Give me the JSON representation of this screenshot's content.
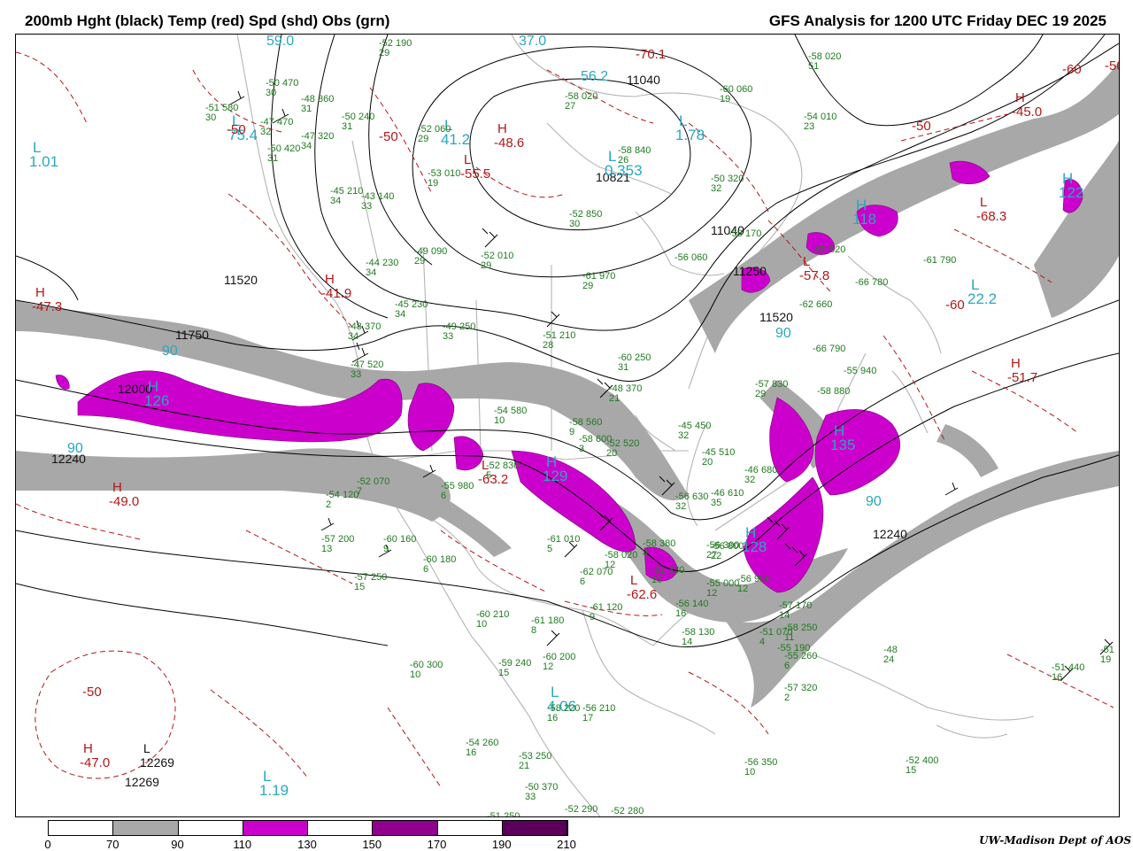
{
  "title_left": "200mb Hght (black) Temp (red) Spd (shd) Obs (grn)",
  "title_right": "GFS Analysis for 1200 UTC Friday  DEC 19 2025",
  "credit": "UW-Madison  Dept of AOS",
  "colors": {
    "height": "#000000",
    "temp": "#b01818",
    "speed_70_90": "#a8a8a8",
    "speed_110_130": "#cc00cc",
    "obs": "#1f7a1f",
    "max_label": "#2aa7bf",
    "coast": "#b4b4b4"
  },
  "legend": {
    "ticks": [
      "0",
      "70",
      "90",
      "110",
      "130",
      "150",
      "170",
      "190",
      "210"
    ],
    "bins": [
      {
        "from": 0,
        "to": 70,
        "color": "#ffffff"
      },
      {
        "from": 70,
        "to": 90,
        "color": "#a8a8a8"
      },
      {
        "from": 90,
        "to": 110,
        "color": "#ffffff"
      },
      {
        "from": 110,
        "to": 130,
        "color": "#cc00cc"
      },
      {
        "from": 130,
        "to": 150,
        "color": "#ffffff"
      },
      {
        "from": 150,
        "to": 170,
        "color": "#8f008f"
      },
      {
        "from": 170,
        "to": 190,
        "color": "#ffffff"
      },
      {
        "from": 190,
        "to": 210,
        "color": "#5a005a"
      }
    ]
  },
  "height_labels": [
    "11040",
    "10821",
    "11040",
    "11250",
    "11520",
    "11520",
    "11750",
    "12000",
    "12240",
    "12240",
    "12269"
  ],
  "extrema": [
    {
      "symbol": "L",
      "value": "1.01",
      "kind": "speed-min"
    },
    {
      "symbol": "L",
      "value": "75.4",
      "kind": "speed-min"
    },
    {
      "symbol": "L",
      "value": "41.2",
      "kind": "speed-min"
    },
    {
      "symbol": "L",
      "value": "0.353",
      "kind": "speed-min"
    },
    {
      "symbol": "L",
      "value": "1.78",
      "kind": "speed-min"
    },
    {
      "symbol": "L",
      "value": "22.2",
      "kind": "speed-min"
    },
    {
      "symbol": "L",
      "value": "4.06",
      "kind": "speed-min"
    },
    {
      "symbol": "L",
      "value": "1.19",
      "kind": "speed-min"
    },
    {
      "symbol": "H",
      "value": "126",
      "kind": "speed-max"
    },
    {
      "symbol": "H",
      "value": "129",
      "kind": "speed-max"
    },
    {
      "symbol": "H",
      "value": "118",
      "kind": "speed-max"
    },
    {
      "symbol": "H",
      "value": "122",
      "kind": "speed-max"
    },
    {
      "symbol": "H",
      "value": "135",
      "kind": "speed-max"
    },
    {
      "symbol": "H",
      "value": "128",
      "kind": "speed-max"
    },
    {
      "symbol": "H",
      "value": "-47.3",
      "kind": "temp-max"
    },
    {
      "symbol": "H",
      "value": "-41.9",
      "kind": "temp-max"
    },
    {
      "symbol": "H",
      "value": "-49.0",
      "kind": "temp-max"
    },
    {
      "symbol": "H",
      "value": "-47.0",
      "kind": "temp-max"
    },
    {
      "symbol": "H",
      "value": "-45.0",
      "kind": "temp-max"
    },
    {
      "symbol": "H",
      "value": "-51.7",
      "kind": "temp-max"
    },
    {
      "symbol": "H",
      "value": "-48.6",
      "kind": "temp-max"
    },
    {
      "symbol": "L",
      "value": "-55.5",
      "kind": "temp-min"
    },
    {
      "symbol": "L",
      "value": "-68.3",
      "kind": "temp-min"
    },
    {
      "symbol": "L",
      "value": "-57.8",
      "kind": "temp-min"
    },
    {
      "symbol": "L",
      "value": "-62.6",
      "kind": "temp-min"
    },
    {
      "symbol": "L",
      "value": "-63.2",
      "kind": "temp-min"
    },
    {
      "symbol": "L",
      "value": "12269",
      "kind": "height-min"
    }
  ],
  "speed_values": [
    "59.0",
    "37.0",
    "56.2",
    "90",
    "90",
    "90",
    "90"
  ],
  "temp_labels": [
    "-50",
    "-50",
    "-50",
    "-50",
    "-60",
    "-60",
    "-50",
    "-70.1"
  ],
  "stations": [
    {
      "t": "-52",
      "h": "190",
      "d": "29"
    },
    {
      "t": "-50",
      "h": "470",
      "d": "30"
    },
    {
      "t": "-51",
      "h": "580",
      "d": "30"
    },
    {
      "t": "-47",
      "h": "470",
      "d": "32"
    },
    {
      "t": "-48",
      "h": "360",
      "d": "31"
    },
    {
      "t": "-47",
      "h": "320",
      "d": "34"
    },
    {
      "t": "-50",
      "h": "420",
      "d": "31"
    },
    {
      "t": "-50",
      "h": "240",
      "d": "31"
    },
    {
      "t": "-52",
      "h": "060",
      "d": "29"
    },
    {
      "t": "-58",
      "h": "020",
      "d": "51"
    },
    {
      "t": "-60",
      "h": "060",
      "d": "19"
    },
    {
      "t": "-58",
      "h": "020",
      "d": "27"
    },
    {
      "t": "-54",
      "h": "010",
      "d": "23"
    },
    {
      "t": "-58",
      "h": "840",
      "d": "26"
    },
    {
      "t": "-53",
      "h": "010",
      "d": "19"
    },
    {
      "t": "-45",
      "h": "210",
      "d": "34"
    },
    {
      "t": "-43",
      "h": "140",
      "d": "33"
    },
    {
      "t": "-50",
      "h": "320",
      "d": "32"
    },
    {
      "t": "-52",
      "h": "850",
      "d": "30"
    },
    {
      "t": "-49",
      "h": "090",
      "d": "29"
    },
    {
      "t": "-52",
      "h": "010",
      "d": "29"
    },
    {
      "t": "-44",
      "h": "230",
      "d": "34"
    },
    {
      "t": "-56",
      "h": "060",
      "d": ""
    },
    {
      "t": "-58",
      "h": "170",
      "d": ""
    },
    {
      "t": "-61",
      "h": "970",
      "d": "29"
    },
    {
      "t": "-61",
      "h": "790",
      "d": ""
    },
    {
      "t": "-60",
      "h": "520",
      "d": ""
    },
    {
      "t": "-66",
      "h": "780",
      "d": ""
    },
    {
      "t": "-45",
      "h": "230",
      "d": "34"
    },
    {
      "t": "-48",
      "h": "370",
      "d": "34"
    },
    {
      "t": "-49",
      "h": "250",
      "d": "33"
    },
    {
      "t": "-51",
      "h": "210",
      "d": "28"
    },
    {
      "t": "-62",
      "h": "660",
      "d": ""
    },
    {
      "t": "-60",
      "h": "250",
      "d": "31"
    },
    {
      "t": "-66",
      "h": "790",
      "d": ""
    },
    {
      "t": "-55",
      "h": "940",
      "d": ""
    },
    {
      "t": "-47",
      "h": "520",
      "d": "33"
    },
    {
      "t": "-48",
      "h": "370",
      "d": "21"
    },
    {
      "t": "-57",
      "h": "830",
      "d": "29"
    },
    {
      "t": "-58",
      "h": "880",
      "d": ""
    },
    {
      "t": "-45",
      "h": "450",
      "d": "32"
    },
    {
      "t": "-45",
      "h": "510",
      "d": "20"
    },
    {
      "t": "-56",
      "h": "800",
      "d": "22"
    },
    {
      "t": "-46",
      "h": "680",
      "d": "32"
    },
    {
      "t": "-54",
      "h": "580",
      "d": "10"
    },
    {
      "t": "-58",
      "h": "560",
      "d": "9"
    },
    {
      "t": "-52",
      "h": "520",
      "d": "20"
    },
    {
      "t": "-58",
      "h": "600",
      "d": "3"
    },
    {
      "t": "-52",
      "h": "830",
      "d": "5"
    },
    {
      "t": "-55",
      "h": "980",
      "d": "6"
    },
    {
      "t": "-52",
      "h": "070",
      "d": "7"
    },
    {
      "t": "-54",
      "h": "120",
      "d": "2"
    },
    {
      "t": "-56",
      "h": "630",
      "d": "32"
    },
    {
      "t": "-46",
      "h": "610",
      "d": "35"
    },
    {
      "t": "-57",
      "h": "200",
      "d": "13"
    },
    {
      "t": "-60",
      "h": "160",
      "d": "9"
    },
    {
      "t": "-60",
      "h": "180",
      "d": "6"
    },
    {
      "t": "-57",
      "h": "250",
      "d": "15"
    },
    {
      "t": "-61",
      "h": "010",
      "d": "5"
    },
    {
      "t": "-62",
      "h": "070",
      "d": "6"
    },
    {
      "t": "-58",
      "h": "020",
      "d": "12"
    },
    {
      "t": "-61",
      "h": "120",
      "d": "9"
    },
    {
      "t": "-58",
      "h": "380",
      "d": "4"
    },
    {
      "t": "-61",
      "h": "330",
      "d": "10"
    },
    {
      "t": "-56",
      "h": "300",
      "d": "27"
    },
    {
      "t": "-56",
      "h": "950",
      "d": "12"
    },
    {
      "t": "-55",
      "h": "000",
      "d": "12"
    },
    {
      "t": "-56",
      "h": "140",
      "d": "16"
    },
    {
      "t": "-58",
      "h": "130",
      "d": "14"
    },
    {
      "t": "-57",
      "h": "170",
      "d": "14"
    },
    {
      "t": "-58",
      "h": "250",
      "d": "11"
    },
    {
      "t": "-55",
      "h": "190",
      "d": ""
    },
    {
      "t": "-60",
      "h": "210",
      "d": "10"
    },
    {
      "t": "-61",
      "h": "180",
      "d": "8"
    },
    {
      "t": "-60",
      "h": "300",
      "d": "10"
    },
    {
      "t": "-59",
      "h": "240",
      "d": "15"
    },
    {
      "t": "-60",
      "h": "200",
      "d": "12"
    },
    {
      "t": "-58",
      "h": "220",
      "d": "16"
    },
    {
      "t": "-56",
      "h": "210",
      "d": "17"
    },
    {
      "t": "-57",
      "h": "320",
      "d": "2"
    },
    {
      "t": "-54",
      "h": "260",
      "d": "16"
    },
    {
      "t": "-53",
      "h": "250",
      "d": "21"
    },
    {
      "t": "-50",
      "h": "370",
      "d": "33"
    },
    {
      "t": "-51",
      "h": "250",
      "d": ""
    },
    {
      "t": "-52",
      "h": "290",
      "d": ""
    },
    {
      "t": "-52",
      "h": "280",
      "d": ""
    },
    {
      "t": "-56",
      "h": "350",
      "d": "10"
    },
    {
      "t": "-52",
      "h": "400",
      "d": "15"
    },
    {
      "t": "-51",
      "h": "440",
      "d": "16"
    },
    {
      "t": "-51",
      "h": "",
      "d": "19"
    },
    {
      "t": "-55",
      "h": "260",
      "d": "6"
    },
    {
      "t": "-51",
      "h": "070",
      "d": "4"
    },
    {
      "t": "-48",
      "h": "",
      "d": "24"
    }
  ]
}
